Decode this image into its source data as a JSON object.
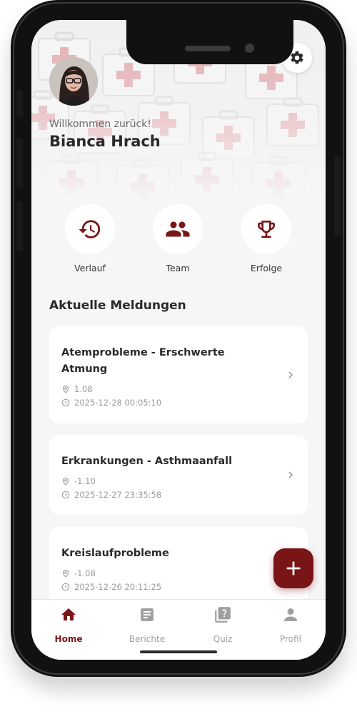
{
  "header": {
    "welcome_text": "Willkommen zurück!",
    "user_name": "Bianca Hrach"
  },
  "quick_actions": [
    {
      "label": "Verlauf",
      "icon": "history-icon"
    },
    {
      "label": "Team",
      "icon": "team-icon"
    },
    {
      "label": "Erfolge",
      "icon": "trophy-icon"
    }
  ],
  "section_title": "Aktuelle Meldungen",
  "reports": [
    {
      "title": "Atemprobleme - Erschwerte Atmung",
      "location": "1.08",
      "timestamp": "2025-12-28 00:05:10"
    },
    {
      "title": "Erkrankungen - Asthmaanfall",
      "location": "-1.10",
      "timestamp": "2025-12-27 23:35:58"
    },
    {
      "title": "Kreislaufprobleme",
      "location": "-1.08",
      "timestamp": "2025-12-26 20:11:25"
    }
  ],
  "fab": {
    "icon": "plus-icon"
  },
  "nav": [
    {
      "label": "Home",
      "icon": "home-icon",
      "active": true
    },
    {
      "label": "Berichte",
      "icon": "document-icon",
      "active": false
    },
    {
      "label": "Quiz",
      "icon": "quiz-icon",
      "active": false
    },
    {
      "label": "Profil",
      "icon": "person-icon",
      "active": false
    }
  ],
  "colors": {
    "accent": "#7a1517",
    "background": "#f6f6f7",
    "card": "#ffffff",
    "text_primary": "#2a2a2a",
    "text_muted": "#9a9a9a"
  }
}
